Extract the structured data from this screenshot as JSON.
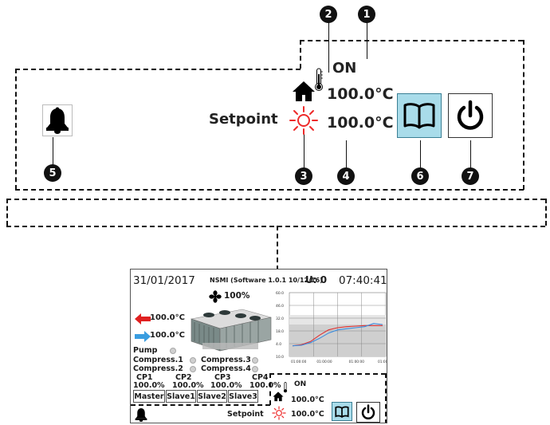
{
  "callouts": [
    "1",
    "2",
    "3",
    "4",
    "5",
    "6",
    "7"
  ],
  "zoom_panel": {
    "status": "ON",
    "home_temp": "100.0°C",
    "setpoint_label": "Setpoint",
    "setpoint_temp": "100.0°C"
  },
  "screen": {
    "date": "31/01/2017",
    "software": "NSMI (Software 1.0.1 10/12/16)",
    "unit": "U: 0",
    "time": "07:40:41",
    "fan_speed": "100%",
    "out_temp": "100.0°C",
    "in_temp": "100.0°C",
    "pump_label": "Pump",
    "compressors": [
      "Compress.1",
      "Compress.3",
      "Compress.2",
      "Compress.4"
    ],
    "cp_labels": [
      "CP1",
      "CP2",
      "CP3",
      "CP4"
    ],
    "cp_values": [
      "100.0%",
      "100.0%",
      "100.0%",
      "100.0%"
    ],
    "tabs": [
      "Master",
      "Slave1",
      "Slave2",
      "Slave3"
    ],
    "status": "ON",
    "home_temp": "100.0°C",
    "setpoint_label": "Setpoint",
    "setpoint_temp": "100.0°C"
  },
  "chart_data": {
    "type": "line",
    "y_ticks": [
      "60.0",
      "46.0",
      "32.0",
      "18.0",
      "4.0",
      "10.0"
    ],
    "x_ticks": [
      "01:00:00",
      "01:00:00",
      "01:00:00",
      "01:00:00"
    ],
    "grid": true,
    "series": [
      {
        "color": "#e03030",
        "values": [
          10,
          11,
          14,
          20,
          25,
          27,
          28,
          28.5,
          29,
          29,
          29
        ]
      },
      {
        "color": "#3a8de0",
        "values": [
          10,
          10.5,
          13,
          17,
          22,
          25,
          26,
          27,
          28,
          31,
          30
        ]
      }
    ]
  },
  "colors": {
    "accent_button": "#a9dcea",
    "arrow_out": "#e02020",
    "arrow_in": "#3a9de0",
    "sun": "#ee2a2a"
  }
}
